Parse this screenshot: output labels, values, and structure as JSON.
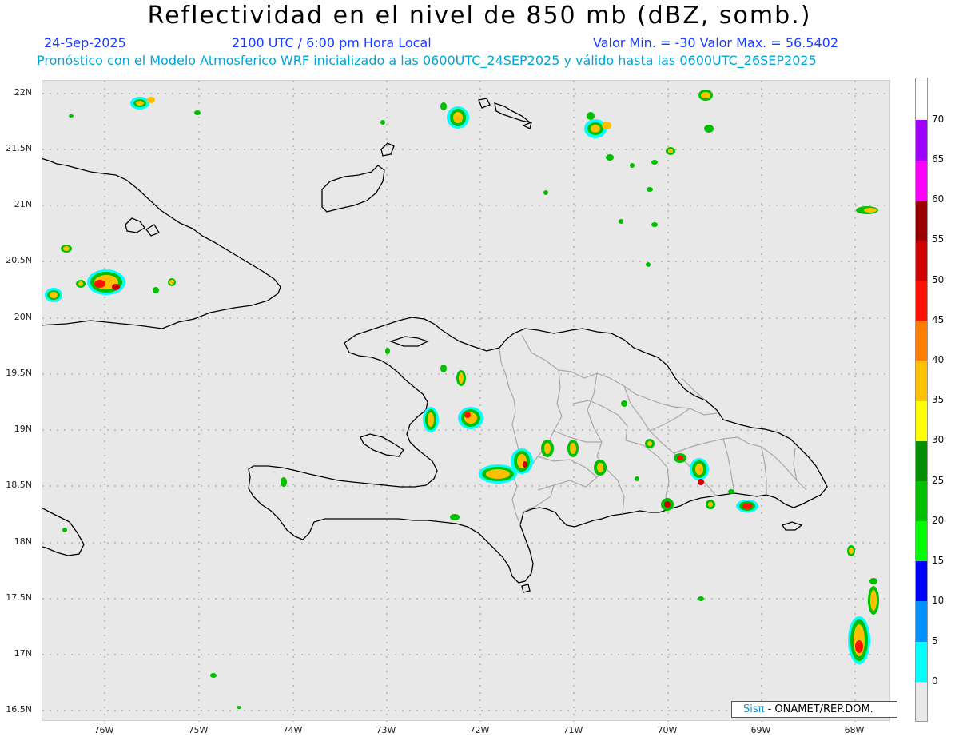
{
  "title": "Reflectividad en el nivel de 850 mb (dBZ, somb.)",
  "date": "24-Sep-2025",
  "time": "2100 UTC / 6:00 pm Hora Local",
  "minmax": "Valor Min. = -30  Valor Max. = 56.5402",
  "model_info": "Pronóstico con el Modelo Atmosferico WRF inicializado a las 0600UTC_24SEP2025 y válido hasta las  0600UTC_26SEP2025",
  "lat_labels": [
    "22N",
    "21.5N",
    "21N",
    "20.5N",
    "20N",
    "19.5N",
    "19N",
    "18.5N",
    "18N",
    "17.5N",
    "17N",
    "16.5N"
  ],
  "lon_labels": [
    "76W",
    "75W",
    "74W",
    "73W",
    "72W",
    "71W",
    "70W",
    "69W",
    "68W"
  ],
  "colorbar": {
    "labels": [
      "70",
      "65",
      "60",
      "55",
      "50",
      "45",
      "40",
      "35",
      "30",
      "25",
      "20",
      "15",
      "10",
      "5",
      "0"
    ],
    "colors": [
      "#a000ff",
      "#ff00ff",
      "#9b0000",
      "#cf0000",
      "#ff1000",
      "#ff7d00",
      "#ffc000",
      "#ffff00",
      "#009000",
      "#00c000",
      "#00ff00",
      "#0000ff",
      "#0090ff",
      "#00ffff"
    ]
  },
  "credit": {
    "brand": "Sisπ",
    "text": " - ONAMET/REP.DOM."
  }
}
